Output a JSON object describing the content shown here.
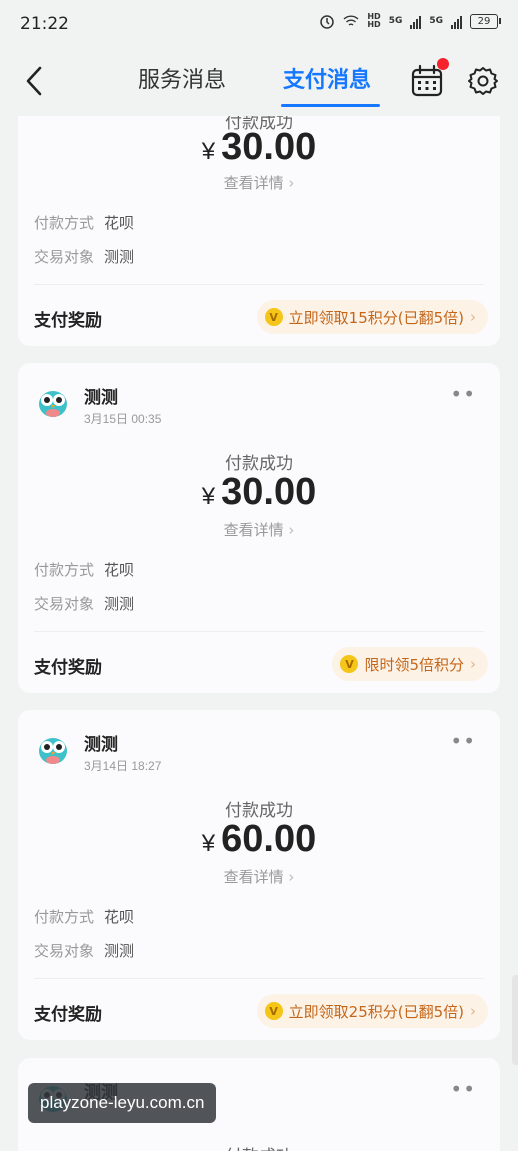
{
  "status_bar": {
    "time": "21:22",
    "net1": "HD",
    "net2": "5G",
    "battery": "29"
  },
  "header": {
    "tab_service": "服务消息",
    "tab_pay": "支付消息"
  },
  "cards": [
    {
      "status": "付款成功",
      "currency": "¥",
      "amount": "30.00",
      "detail": "查看详情",
      "method_label": "付款方式",
      "method": "花呗",
      "target_label": "交易对象",
      "target": "测测",
      "reward_label": "支付奖励",
      "reward": "立即领取15积分(已翻5倍)"
    },
    {
      "merchant": "测测",
      "date": "3月15日 00:35",
      "status": "付款成功",
      "currency": "¥",
      "amount": "30.00",
      "detail": "查看详情",
      "method_label": "付款方式",
      "method": "花呗",
      "target_label": "交易对象",
      "target": "测测",
      "reward_label": "支付奖励",
      "reward": "限时领5倍积分"
    },
    {
      "merchant": "测测",
      "date": "3月14日 18:27",
      "status": "付款成功",
      "currency": "¥",
      "amount": "60.00",
      "detail": "查看详情",
      "method_label": "付款方式",
      "method": "花呗",
      "target_label": "交易对象",
      "target": "测测",
      "reward_label": "支付奖励",
      "reward": "立即领取25积分(已翻5倍)"
    },
    {
      "merchant": "测测",
      "status": "付款成功"
    }
  ],
  "watermark": "playzone-leyu.com.cn",
  "colors": {
    "accent": "#1677ff",
    "badge": "#f5222d",
    "reward_text": "#c4661a",
    "reward_bg": "#fdf2e6"
  }
}
